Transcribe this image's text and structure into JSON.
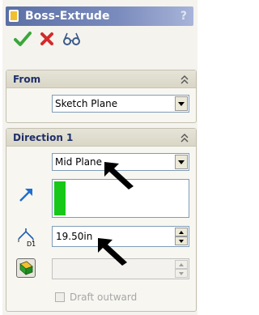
{
  "panel": {
    "title": "Boss-Extrude",
    "help_label": "?"
  },
  "toolbar": {
    "ok_icon": "green-check-icon",
    "cancel_icon": "red-x-icon",
    "preview_icon": "glasses-icon"
  },
  "from_group": {
    "title": "From",
    "start_condition": "Sketch Plane"
  },
  "direction1_group": {
    "title": "Direction 1",
    "end_condition": "Mid Plane",
    "depth_value": "19.50in",
    "depth_icon_label": "D1",
    "draft_angle_value": "",
    "draft_outward_label": "Draft outward",
    "draft_outward_checked": false
  },
  "colors": {
    "title_bar": "#5b6fa6",
    "group_title": "#1f2f6a",
    "selection_green": "#18c818",
    "ok_green": "#3aa73a",
    "cancel_red": "#d42a2a"
  }
}
